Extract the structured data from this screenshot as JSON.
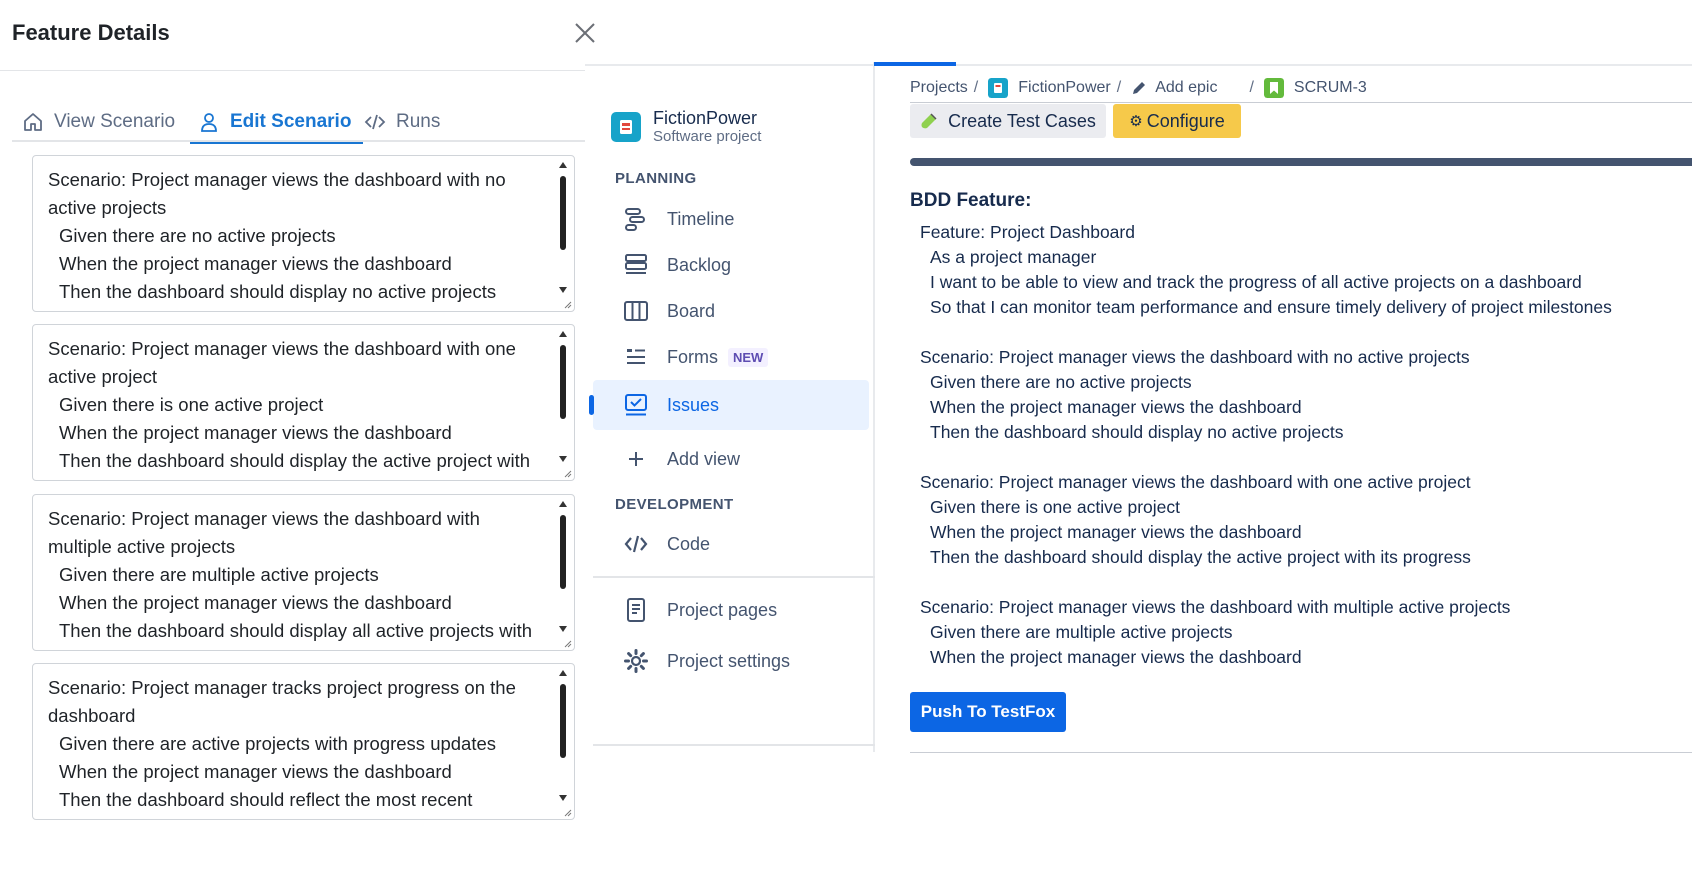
{
  "drawer": {
    "title": "Feature Details",
    "tabs": [
      {
        "label": "View Scenario",
        "icon": "home-icon"
      },
      {
        "label": "Edit Scenario",
        "icon": "user-icon"
      },
      {
        "label": "Runs",
        "icon": "code-icon"
      }
    ],
    "scenarios": [
      {
        "title": "Scenario: Project manager views the dashboard with no active projects",
        "given": "Given there are no active projects",
        "when": "When the project manager views the dashboard",
        "then": "Then the dashboard should display no active projects"
      },
      {
        "title": "Scenario: Project manager views the dashboard with one active project",
        "given": "Given there is one active project",
        "when": "When the project manager views the dashboard",
        "then": "Then the dashboard should display the active project with"
      },
      {
        "title": "Scenario: Project manager views the dashboard with multiple active projects",
        "given": "Given there are multiple active projects",
        "when": "When the project manager views the dashboard",
        "then": "Then the dashboard should display all active projects with"
      },
      {
        "title": "Scenario: Project manager tracks project progress on the dashboard",
        "given": "Given there are active projects with progress updates",
        "when": "When the project manager views the dashboard",
        "then": "Then the dashboard should reflect the most recent"
      }
    ]
  },
  "sidebar": {
    "project_name": "FictionPower",
    "project_type": "Software project",
    "planning_label": "PLANNING",
    "development_label": "DEVELOPMENT",
    "items": {
      "timeline": "Timeline",
      "backlog": "Backlog",
      "board": "Board",
      "forms": "Forms",
      "forms_badge": "NEW",
      "issues": "Issues",
      "add_view": "Add view",
      "code": "Code",
      "project_pages": "Project pages",
      "project_settings": "Project settings"
    }
  },
  "breadcrumb": {
    "projects": "Projects",
    "project": "FictionPower",
    "add_epic": "Add epic",
    "issue": "SCRUM-3",
    "separator": "/"
  },
  "toolbar": {
    "create_test_cases": "Create Test Cases",
    "configure": "Configure"
  },
  "bdd": {
    "label": "BDD Feature:",
    "lines": [
      {
        "text": "Feature: Project Dashboard",
        "indent": false
      },
      {
        "text": "As a project manager",
        "indent": true
      },
      {
        "text": "I want to be able to view and track the progress of all active projects on a dashboard",
        "indent": true
      },
      {
        "text": "So that I can monitor team performance and ensure timely delivery of project milestones",
        "indent": true
      },
      {
        "text": "",
        "indent": false
      },
      {
        "text": "Scenario: Project manager views the dashboard with no active projects",
        "indent": false
      },
      {
        "text": "Given there are no active projects",
        "indent": true
      },
      {
        "text": "When the project manager views the dashboard",
        "indent": true
      },
      {
        "text": "Then the dashboard should display no active projects",
        "indent": true
      },
      {
        "text": "",
        "indent": false
      },
      {
        "text": "Scenario: Project manager views the dashboard with one active project",
        "indent": false
      },
      {
        "text": "Given there is one active project",
        "indent": true
      },
      {
        "text": "When the project manager views the dashboard",
        "indent": true
      },
      {
        "text": "Then the dashboard should display the active project with its progress",
        "indent": true
      },
      {
        "text": "",
        "indent": false
      },
      {
        "text": "Scenario: Project manager views the dashboard with multiple active projects",
        "indent": false
      },
      {
        "text": "Given there are multiple active projects",
        "indent": true
      },
      {
        "text": "When the project manager views the dashboard",
        "indent": true
      }
    ],
    "push_button": "Push To TestFox"
  },
  "colors": {
    "tab_active": "#1976d2",
    "nav_active_bg": "#e9f2ff",
    "primary": "#0c66e4",
    "configure_bg": "#f6c94a",
    "progress_bar": "#44546f"
  }
}
